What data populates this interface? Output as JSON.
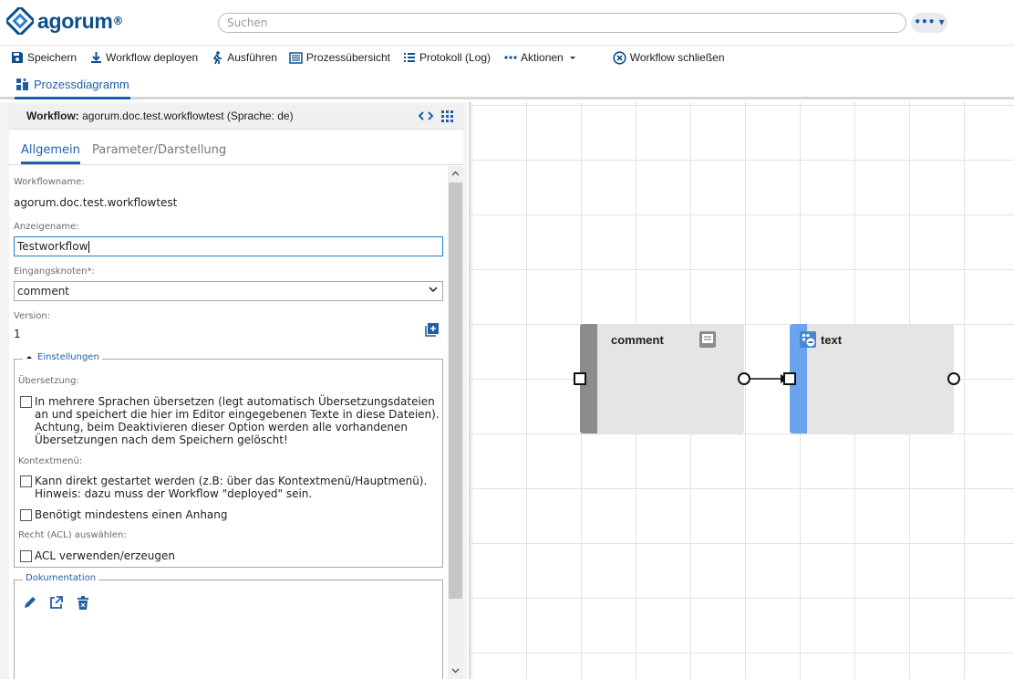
{
  "app": {
    "logo_text": "agorum",
    "logo_mark": "®"
  },
  "header": {
    "search_placeholder": "Suchen",
    "more_label": "••• ▾"
  },
  "toolbar": {
    "items": [
      {
        "label": "Speichern",
        "icon": "save-icon"
      },
      {
        "label": "Workflow deployen",
        "icon": "download-icon"
      },
      {
        "label": "Ausführen",
        "icon": "run-icon"
      },
      {
        "label": "Prozessübersicht",
        "icon": "overview-icon"
      },
      {
        "label": "Protokoll (Log)",
        "icon": "list-icon"
      },
      {
        "label": "Aktionen",
        "icon": "more-icon"
      },
      {
        "label": "Workflow schließen",
        "icon": "close-circle-icon"
      }
    ]
  },
  "subtab": {
    "label": "Prozessdiagramm"
  },
  "panel": {
    "header_bold": "Workflow:",
    "header_text": "agorum.doc.test.workflowtest (Sprache: de)",
    "tabs": {
      "active": "Allgemein",
      "inactive": "Parameter/Darstellung"
    },
    "workflowname_label": "Workflowname:",
    "workflowname_value": "agorum.doc.test.workflowtest",
    "anzeigename_label": "Anzeigename:",
    "anzeigename_value": "Testworkflow",
    "eingangsknoten_label": "Eingangsknoten*:",
    "eingangsknoten_value": "comment",
    "version_label": "Version:",
    "version_value": "1",
    "einstellungen": {
      "legend": "Einstellungen",
      "uebersetzung_label": "Übersetzung:",
      "cb1_text": "In mehrere Sprachen übersetzen (legt automatisch Übersetzungsdateien an und speichert die hier im Editor eingegebenen Texte in diese Dateien). Achtung, beim Deaktivieren dieser Option werden alle vorhandenen Übersetzungen nach dem Speichern gelöscht!",
      "kontextmenue_label": "Kontextmenü:",
      "cb2_text": "Kann direkt gestartet werden (z.B: über das Kontextmenü/Hauptmenü). Hinweis: dazu muss der Workflow \"deployed\" sein.",
      "cb3_text": "Benötigt mindestens einen Anhang",
      "acl_label": "Recht (ACL) auswählen:",
      "cb4_text": "ACL verwenden/erzeugen"
    },
    "dokumentation": {
      "legend": "Dokumentation"
    }
  },
  "diagram": {
    "nodes": [
      {
        "title": "comment",
        "bar_color": "#8c8c8c"
      },
      {
        "title": "text",
        "bar_color": "#6aa3ee"
      }
    ]
  },
  "colors": {
    "accent": "#1f5fa8",
    "brand": "#0e4f8c"
  }
}
